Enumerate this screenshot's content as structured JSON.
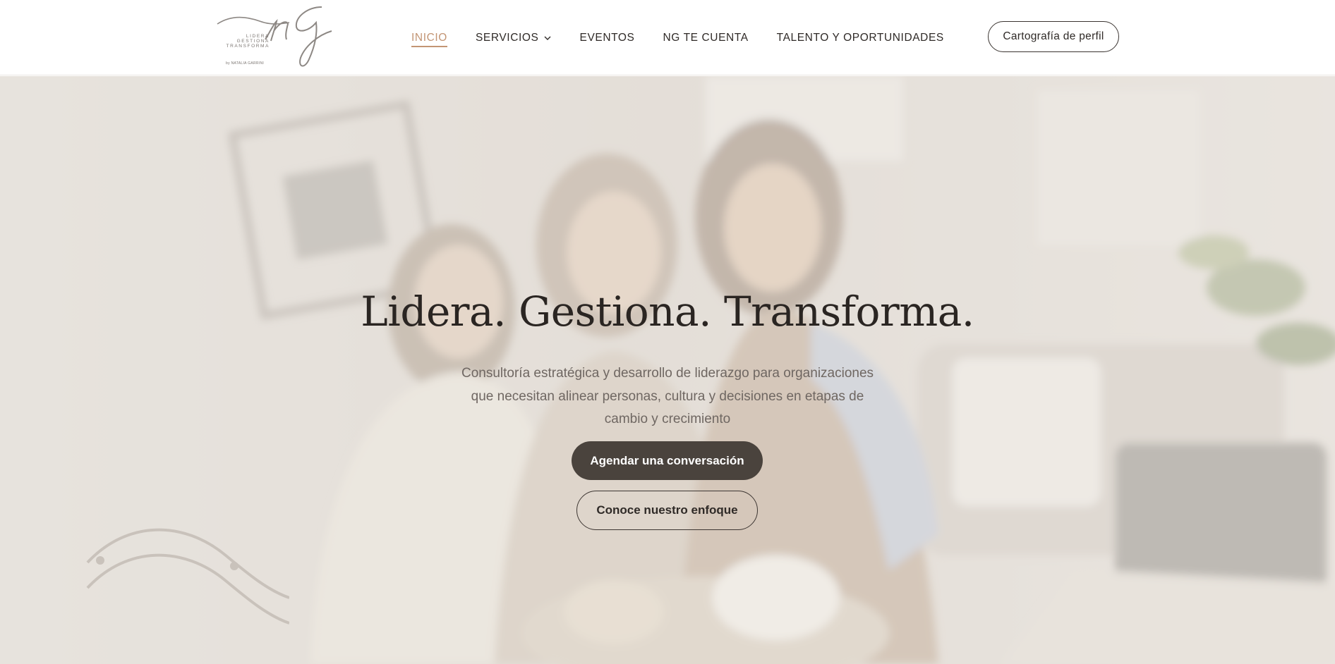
{
  "logo": {
    "line1": "LIDERA",
    "line2": "GESTIONA",
    "line3": "TRANSFORMA",
    "byline": "by NATALIA GARRINI"
  },
  "nav": {
    "items": [
      {
        "label": "INICIO",
        "active": true
      },
      {
        "label": "SERVICIOS",
        "has_dropdown": true
      },
      {
        "label": "EVENTOS"
      },
      {
        "label": "NG TE CUENTA"
      },
      {
        "label": "TALENTO Y OPORTUNIDADES"
      }
    ],
    "cta_label": "Cartografía de perfil"
  },
  "hero": {
    "title": "Lidera. Gestiona. Transforma.",
    "subtitle": "Consultoría estratégica y desarrollo de liderazgo para organizaciones que necesitan alinear personas, cultura y decisiones en etapas de cambio y crecimiento",
    "primary_button": "Agendar una conversación",
    "secondary_button": "Conoce nuestro enfoque"
  },
  "icons": {
    "dropdown": "chevron-down-icon"
  },
  "colors": {
    "accent": "#c39574",
    "primary_button_bg": "#4a433d",
    "text_dark": "#2a2522",
    "text_muted": "#6f6762"
  }
}
